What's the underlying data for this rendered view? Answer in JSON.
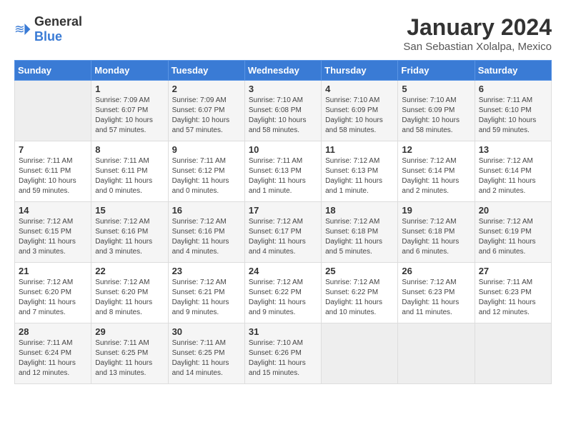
{
  "logo": {
    "general": "General",
    "blue": "Blue"
  },
  "title": "January 2024",
  "subtitle": "San Sebastian Xolalpa, Mexico",
  "headers": [
    "Sunday",
    "Monday",
    "Tuesday",
    "Wednesday",
    "Thursday",
    "Friday",
    "Saturday"
  ],
  "weeks": [
    [
      {
        "day": "",
        "info": ""
      },
      {
        "day": "1",
        "info": "Sunrise: 7:09 AM\nSunset: 6:07 PM\nDaylight: 10 hours\nand 57 minutes."
      },
      {
        "day": "2",
        "info": "Sunrise: 7:09 AM\nSunset: 6:07 PM\nDaylight: 10 hours\nand 57 minutes."
      },
      {
        "day": "3",
        "info": "Sunrise: 7:10 AM\nSunset: 6:08 PM\nDaylight: 10 hours\nand 58 minutes."
      },
      {
        "day": "4",
        "info": "Sunrise: 7:10 AM\nSunset: 6:09 PM\nDaylight: 10 hours\nand 58 minutes."
      },
      {
        "day": "5",
        "info": "Sunrise: 7:10 AM\nSunset: 6:09 PM\nDaylight: 10 hours\nand 58 minutes."
      },
      {
        "day": "6",
        "info": "Sunrise: 7:11 AM\nSunset: 6:10 PM\nDaylight: 10 hours\nand 59 minutes."
      }
    ],
    [
      {
        "day": "7",
        "info": "Sunrise: 7:11 AM\nSunset: 6:11 PM\nDaylight: 10 hours\nand 59 minutes."
      },
      {
        "day": "8",
        "info": "Sunrise: 7:11 AM\nSunset: 6:11 PM\nDaylight: 11 hours\nand 0 minutes."
      },
      {
        "day": "9",
        "info": "Sunrise: 7:11 AM\nSunset: 6:12 PM\nDaylight: 11 hours\nand 0 minutes."
      },
      {
        "day": "10",
        "info": "Sunrise: 7:11 AM\nSunset: 6:13 PM\nDaylight: 11 hours\nand 1 minute."
      },
      {
        "day": "11",
        "info": "Sunrise: 7:12 AM\nSunset: 6:13 PM\nDaylight: 11 hours\nand 1 minute."
      },
      {
        "day": "12",
        "info": "Sunrise: 7:12 AM\nSunset: 6:14 PM\nDaylight: 11 hours\nand 2 minutes."
      },
      {
        "day": "13",
        "info": "Sunrise: 7:12 AM\nSunset: 6:14 PM\nDaylight: 11 hours\nand 2 minutes."
      }
    ],
    [
      {
        "day": "14",
        "info": "Sunrise: 7:12 AM\nSunset: 6:15 PM\nDaylight: 11 hours\nand 3 minutes."
      },
      {
        "day": "15",
        "info": "Sunrise: 7:12 AM\nSunset: 6:16 PM\nDaylight: 11 hours\nand 3 minutes."
      },
      {
        "day": "16",
        "info": "Sunrise: 7:12 AM\nSunset: 6:16 PM\nDaylight: 11 hours\nand 4 minutes."
      },
      {
        "day": "17",
        "info": "Sunrise: 7:12 AM\nSunset: 6:17 PM\nDaylight: 11 hours\nand 4 minutes."
      },
      {
        "day": "18",
        "info": "Sunrise: 7:12 AM\nSunset: 6:18 PM\nDaylight: 11 hours\nand 5 minutes."
      },
      {
        "day": "19",
        "info": "Sunrise: 7:12 AM\nSunset: 6:18 PM\nDaylight: 11 hours\nand 6 minutes."
      },
      {
        "day": "20",
        "info": "Sunrise: 7:12 AM\nSunset: 6:19 PM\nDaylight: 11 hours\nand 6 minutes."
      }
    ],
    [
      {
        "day": "21",
        "info": "Sunrise: 7:12 AM\nSunset: 6:20 PM\nDaylight: 11 hours\nand 7 minutes."
      },
      {
        "day": "22",
        "info": "Sunrise: 7:12 AM\nSunset: 6:20 PM\nDaylight: 11 hours\nand 8 minutes."
      },
      {
        "day": "23",
        "info": "Sunrise: 7:12 AM\nSunset: 6:21 PM\nDaylight: 11 hours\nand 9 minutes."
      },
      {
        "day": "24",
        "info": "Sunrise: 7:12 AM\nSunset: 6:22 PM\nDaylight: 11 hours\nand 9 minutes."
      },
      {
        "day": "25",
        "info": "Sunrise: 7:12 AM\nSunset: 6:22 PM\nDaylight: 11 hours\nand 10 minutes."
      },
      {
        "day": "26",
        "info": "Sunrise: 7:12 AM\nSunset: 6:23 PM\nDaylight: 11 hours\nand 11 minutes."
      },
      {
        "day": "27",
        "info": "Sunrise: 7:11 AM\nSunset: 6:23 PM\nDaylight: 11 hours\nand 12 minutes."
      }
    ],
    [
      {
        "day": "28",
        "info": "Sunrise: 7:11 AM\nSunset: 6:24 PM\nDaylight: 11 hours\nand 12 minutes."
      },
      {
        "day": "29",
        "info": "Sunrise: 7:11 AM\nSunset: 6:25 PM\nDaylight: 11 hours\nand 13 minutes."
      },
      {
        "day": "30",
        "info": "Sunrise: 7:11 AM\nSunset: 6:25 PM\nDaylight: 11 hours\nand 14 minutes."
      },
      {
        "day": "31",
        "info": "Sunrise: 7:10 AM\nSunset: 6:26 PM\nDaylight: 11 hours\nand 15 minutes."
      },
      {
        "day": "",
        "info": ""
      },
      {
        "day": "",
        "info": ""
      },
      {
        "day": "",
        "info": ""
      }
    ]
  ]
}
